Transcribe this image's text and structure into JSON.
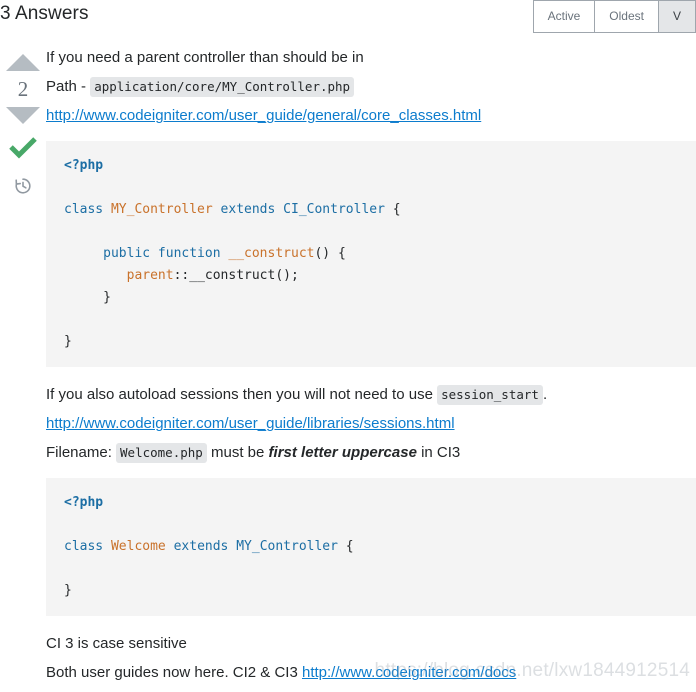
{
  "header": {
    "title": "3 Answers",
    "tabs": [
      {
        "label": "Active",
        "selected": false
      },
      {
        "label": "Oldest",
        "selected": false
      },
      {
        "label": "V",
        "selected": true
      }
    ]
  },
  "answer": {
    "vote": {
      "up_icon": "arrow-up-icon",
      "score": "2",
      "down_icon": "arrow-down-icon",
      "accepted_icon": "checkmark-icon",
      "history_icon": "history-clock-icon"
    },
    "paragraphs": {
      "intro": "If you need a parent controller than should be in",
      "path_label": "Path -",
      "path_code": "application/core/MY_Controller.php",
      "link1": "http://www.codeigniter.com/user_guide/general/core_classes.html",
      "autoload_pre": "If you also autoload sessions then you will not need to use",
      "autoload_code": "session_start",
      "autoload_post": ".",
      "link2": "http://www.codeigniter.com/user_guide/libraries/sessions.html",
      "filename_label": "Filename:",
      "filename_code": "Welcome.php",
      "filename_mid": "must be",
      "filename_emphasis": "first letter uppercase",
      "filename_tail": "in CI3",
      "case_sensitive": "CI 3 is case sensitive",
      "guides_pre": "Both user guides now here. CI2 & CI3",
      "link3": "http://www.codeigniter.com/docs"
    },
    "code_block_1": {
      "lines": [
        [
          {
            "t": "<?php",
            "c": "tok-php"
          }
        ],
        [],
        [
          {
            "t": "class ",
            "c": "tok-kw"
          },
          {
            "t": "MY_Controller ",
            "c": "tok-fn"
          },
          {
            "t": "extends ",
            "c": "tok-kw"
          },
          {
            "t": "CI_Controller ",
            "c": "tok-cls"
          },
          {
            "t": "{",
            "c": "tok-plain"
          }
        ],
        [],
        [
          {
            "t": "     ",
            "c": "tok-plain"
          },
          {
            "t": "public function ",
            "c": "tok-kw"
          },
          {
            "t": "__construct",
            "c": "tok-fn"
          },
          {
            "t": "() {",
            "c": "tok-plain"
          }
        ],
        [
          {
            "t": "        ",
            "c": "tok-plain"
          },
          {
            "t": "parent",
            "c": "tok-var"
          },
          {
            "t": "::__construct();",
            "c": "tok-plain"
          }
        ],
        [
          {
            "t": "     }",
            "c": "tok-plain"
          }
        ],
        [],
        [
          {
            "t": "}",
            "c": "tok-plain"
          }
        ]
      ]
    },
    "code_block_2": {
      "lines": [
        [
          {
            "t": "<?php",
            "c": "tok-php"
          }
        ],
        [],
        [
          {
            "t": "class ",
            "c": "tok-kw"
          },
          {
            "t": "Welcome ",
            "c": "tok-fn"
          },
          {
            "t": "extends ",
            "c": "tok-kw"
          },
          {
            "t": "MY_Controller ",
            "c": "tok-cls"
          },
          {
            "t": "{",
            "c": "tok-plain"
          }
        ],
        [],
        [
          {
            "t": "}",
            "c": "tok-plain"
          }
        ]
      ]
    }
  },
  "watermark": {
    "text": "https://blog.csdn.net/lxw1844912514"
  },
  "colors": {
    "link": "#0c7ccd",
    "accepted_green": "#48a868",
    "arrow_grey": "#b5bcc2",
    "code_bg": "#f4f4f4",
    "inline_code_bg": "#e4e6e8",
    "tab_border": "#9fa6ad",
    "tab_selected_bg": "#e4e6e8"
  }
}
